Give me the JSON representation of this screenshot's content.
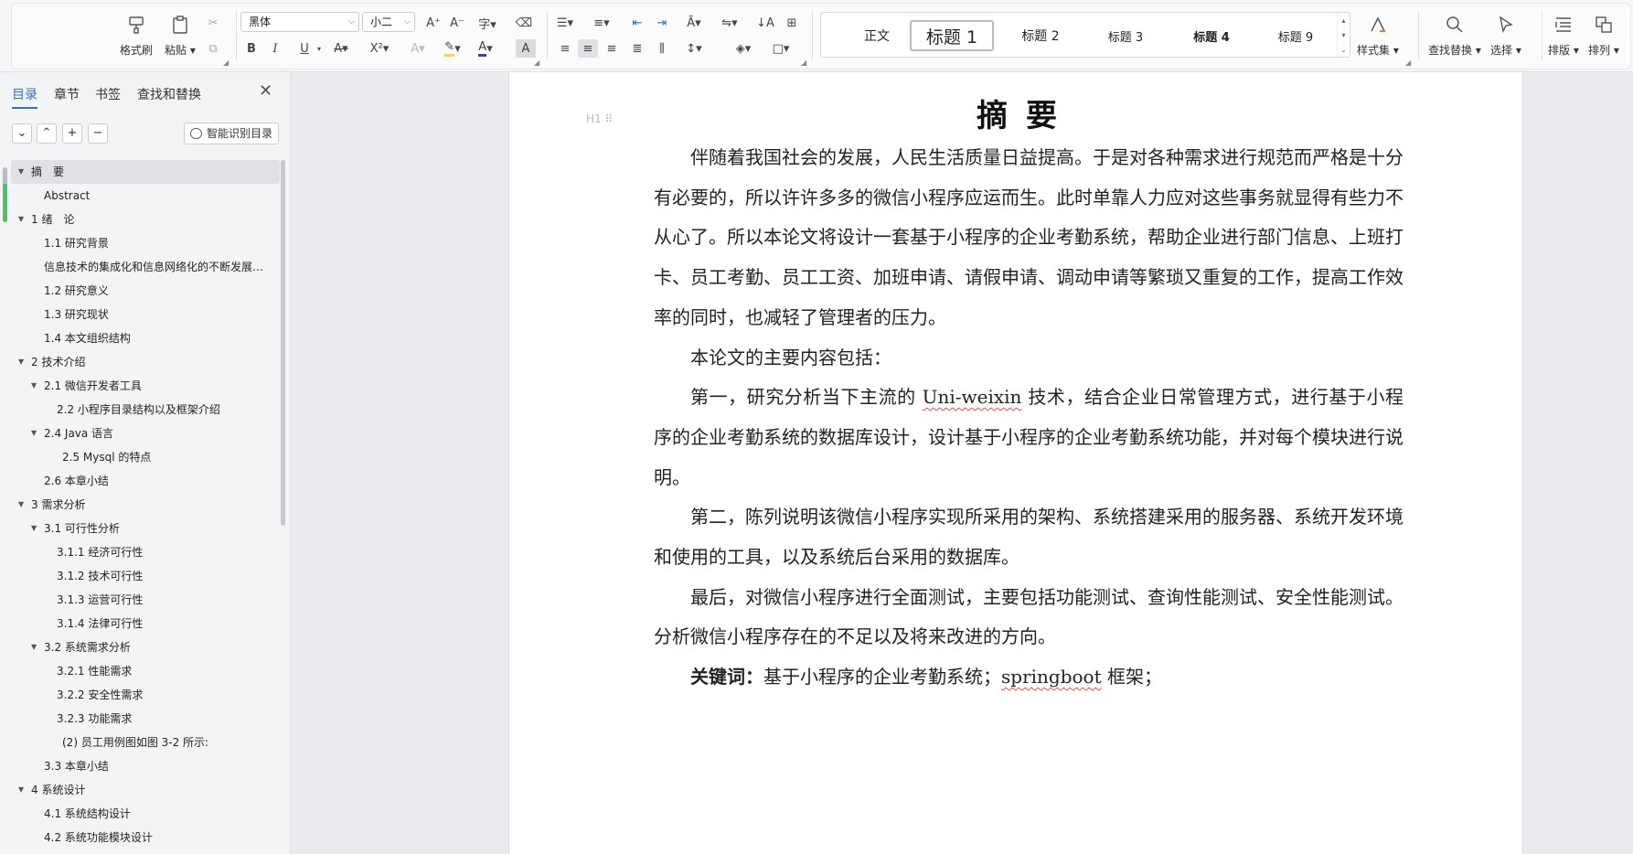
{
  "ribbon": {
    "format_painter": "格式刷",
    "paste": "粘贴",
    "font_name": "黑体",
    "font_size": "小二",
    "bold": "B",
    "italic": "I",
    "underline": "U",
    "styles": [
      "正文",
      "标题 1",
      "标题 2",
      "标题 3",
      "标题 4",
      "标题 9"
    ],
    "style_set": "样式集",
    "find_replace": "查找替换",
    "select": "选择",
    "layout": "排版",
    "arrange": "排列"
  },
  "sidebar": {
    "tabs": [
      "目录",
      "章节",
      "书签",
      "查找和替换"
    ],
    "smart_toc": "智能识别目录",
    "toc": [
      {
        "label": "摘　要",
        "level": 1,
        "arrow": true,
        "active": true
      },
      {
        "label": "Abstract",
        "level": 2,
        "arrow": false
      },
      {
        "label": "1 绪　论",
        "level": 1,
        "arrow": true
      },
      {
        "label": "1.1 研究背景",
        "level": 2,
        "arrow": false
      },
      {
        "label": "信息技术的集成化和信息网络化的不断发展，...",
        "level": 2,
        "arrow": false
      },
      {
        "label": "1.2  研究意义",
        "level": 2,
        "arrow": false
      },
      {
        "label": "1.3 研究现状",
        "level": 2,
        "arrow": false
      },
      {
        "label": "1.4 本文组织结构",
        "level": 2,
        "arrow": false
      },
      {
        "label": "2 技术介绍",
        "level": 1,
        "arrow": true
      },
      {
        "label": "2.1 微信开发者工具",
        "level": 2,
        "arrow": true
      },
      {
        "label": "2.2 小程序目录结构以及框架介绍",
        "level": 3,
        "arrow": false
      },
      {
        "label": "2.4 Java 语言",
        "level": 2,
        "arrow": true
      },
      {
        "label": "2.5 Mysql 的特点",
        "level": 3.4,
        "arrow": false
      },
      {
        "label": "2.6 本章小结",
        "level": 2,
        "arrow": false
      },
      {
        "label": "3 需求分析",
        "level": 1,
        "arrow": true
      },
      {
        "label": "3.1 可行性分析",
        "level": 2,
        "arrow": true
      },
      {
        "label": "3.1.1 经济可行性",
        "level": 3,
        "arrow": false
      },
      {
        "label": "3.1.2 技术可行性",
        "level": 3,
        "arrow": false
      },
      {
        "label": "3.1.3 运营可行性",
        "level": 3,
        "arrow": false
      },
      {
        "label": "3.1.4 法律可行性",
        "level": 3,
        "arrow": false
      },
      {
        "label": "3.2 系统需求分析",
        "level": 2,
        "arrow": true
      },
      {
        "label": "3.2.1  性能需求",
        "level": 3,
        "arrow": false
      },
      {
        "label": "3.2.2  安全性需求",
        "level": 3,
        "arrow": false
      },
      {
        "label": "3.2.3 功能需求",
        "level": 3,
        "arrow": false
      },
      {
        "label": "(2)    员工用例图如图 3-2 所示:",
        "level": 3.5,
        "arrow": false
      },
      {
        "label": "3.3 本章小结",
        "level": 2,
        "arrow": false
      },
      {
        "label": "4 系统设计",
        "level": 1,
        "arrow": true
      },
      {
        "label": "4.1 系统结构设计",
        "level": 2,
        "arrow": false
      },
      {
        "label": "4.2 系统功能模块设计",
        "level": 2,
        "arrow": false
      }
    ]
  },
  "document": {
    "heading_marker": "H1",
    "title": "摘要",
    "paragraphs": [
      [
        "伴随着我国社会的发展，人民生活质量日益提高。于是对各种需求进行规范而严格是十分有必要的，所以许许多多的微信小程序应运而生。此时单靠人力应对这些事务就显得有些力不从心了。所以本论文将设计一套基于小程序的企业考勤系统，帮助企业进行部门信息、上班打卡、员工考勤、员工工资、加班申请、请假申请、调动申请等繁琐又重复的工作，提高工作效率的同时，也减轻了管理者的压力。"
      ],
      [
        "本论文的主要内容包括："
      ],
      [
        "第一，研究分析当下主流的 ",
        "Uni-weixin",
        " 技术，结合企业日常管理方式，进行基于小程序的企业考勤系统的数据库设计，设计基于小程序的企业考勤系统功能，并对每个模块进行说明。"
      ],
      [
        "第二，陈列说明该微信小程序实现所采用的架构、系统搭建采用的服务器、系统开发环境和使用的工具，以及系统后台采用的数据库。"
      ],
      [
        "最后，对微信小程序进行全面测试，主要包括功能测试、查询性能测试、安全性能测试。分析微信小程序存在的不足以及将来改进的方向。"
      ]
    ],
    "keywords_label": "关键词：",
    "keywords_pre": "基于小程序的企业考勤系统；",
    "keywords_term": "springboot",
    "keywords_post": " 框架；"
  }
}
